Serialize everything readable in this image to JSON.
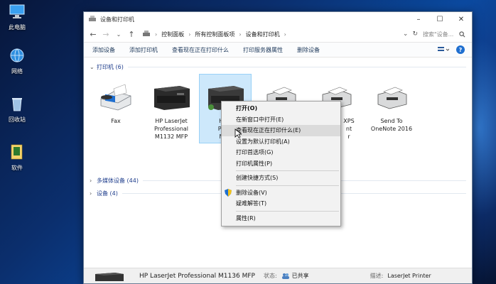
{
  "desktop": {
    "icons": [
      {
        "label": "此电脑",
        "icon": "computer-icon"
      },
      {
        "label": "网络",
        "icon": "network-icon"
      },
      {
        "label": "回收站",
        "icon": "recycle-bin-icon"
      },
      {
        "label": "软件",
        "icon": "folder-icon"
      }
    ]
  },
  "window": {
    "title": "设备和打印机",
    "address": {
      "parts": [
        "控制面板",
        "所有控制面板项",
        "设备和打印机"
      ]
    },
    "search_placeholder": "搜索\"设备...",
    "toolbar": {
      "buttons": [
        "添加设备",
        "添加打印机",
        "查看现在正在打印什么",
        "打印服务器属性",
        "删除设备"
      ]
    },
    "groups": {
      "printers": "打印机 (6)",
      "multimedia": "多媒体设备 (44)",
      "devices": "设备 (4)"
    },
    "printers": [
      {
        "line1": "Fax",
        "line2": "",
        "line3": ""
      },
      {
        "line1": "HP LaserJet",
        "line2": "Professional",
        "line3": "M1132 MFP"
      },
      {
        "line1": "HP L",
        "line2": "Profe",
        "line3": "M11"
      },
      {
        "line1": "",
        "line2": "",
        "line3": ""
      },
      {
        "line1": "XPS",
        "line2": "nt",
        "line3": "r"
      },
      {
        "line1": "Send To",
        "line2": "OneNote 2016",
        "line3": ""
      }
    ],
    "statusbar": {
      "name": "HP LaserJet Professional M1136 MFP",
      "state_label": "状态:",
      "state_value": "已共享",
      "desc_label": "描述:",
      "desc_value": "LaserJet Printer"
    }
  },
  "context_menu": {
    "items": [
      {
        "label": "打开(O)",
        "bold": true
      },
      {
        "label": "在新窗口中打开(E)"
      },
      {
        "label": "查看现在正在打印什么(E)",
        "hover": true
      },
      {
        "label": "设置为默认打印机(A)"
      },
      {
        "label": "打印首选项(G)"
      },
      {
        "label": "打印机属性(P)"
      },
      {
        "label": "创建快捷方式(S)"
      },
      {
        "label": "删除设备(V)",
        "shield": true
      },
      {
        "label": "疑难解答(T)"
      },
      {
        "label": "属性(R)"
      }
    ]
  },
  "colors": {
    "accent": "#1f6fd0",
    "selection": "#cde8fb",
    "group_text": "#1e3d8c"
  }
}
